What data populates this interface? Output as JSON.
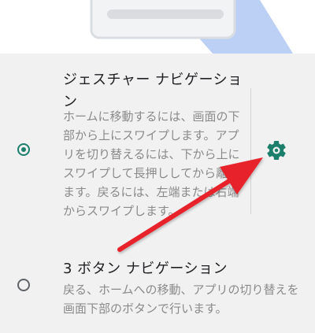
{
  "options": [
    {
      "title": "ジェスチャー ナビゲーション",
      "description": "ホームに移動するには、画面の下部から上にスワイプします。アプリを切り替えるには、下から上にスワイプして長押ししてから離します。戻るには、左端または右端からスワイプします。",
      "selected": true
    },
    {
      "title": "3 ボタン ナビゲーション",
      "description": "戻る、ホームへの移動、アプリの切り替えを画面下部のボタンで行います。",
      "selected": false
    }
  ],
  "colors": {
    "accent": "#1b7f6b",
    "arrow": "#e8202a"
  },
  "icons": {
    "settings": "gear-icon"
  }
}
